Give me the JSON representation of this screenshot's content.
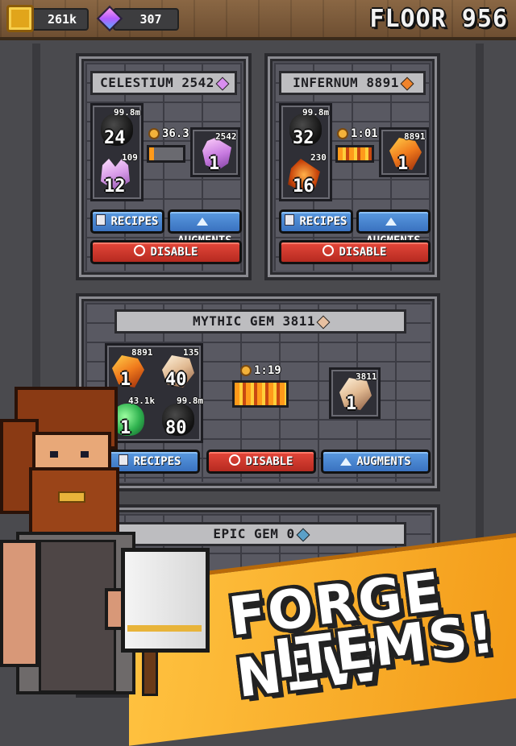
{
  "header": {
    "gold_amount": "261k",
    "gem_amount": "307",
    "floor_label": "FLOOR 956",
    "gold_icon": "gold-coin-icon",
    "gem_icon": "purple-gem-icon"
  },
  "forges": [
    {
      "title": "CELESTIUM 2542",
      "inputs": [
        {
          "icon": "coal-icon",
          "stock": "99.8m",
          "required": "24"
        },
        {
          "icon": "celestium-crystal-icon",
          "stock": "109",
          "required": "12"
        }
      ],
      "timer": "36.3",
      "progress": 0.15,
      "output": {
        "icon": "celestium-bar-icon",
        "stock": "2542",
        "count": "1"
      },
      "recipes_label": "RECIPES",
      "augments_label": "AUGMENTS",
      "disable_label": "DISABLE"
    },
    {
      "title": "INFERNUM 8891",
      "inputs": [
        {
          "icon": "coal-icon",
          "stock": "99.8m",
          "required": "32"
        },
        {
          "icon": "infernum-ember-icon",
          "stock": "230",
          "required": "16"
        }
      ],
      "timer": "1:01",
      "progress": 1.0,
      "output": {
        "icon": "infernum-bar-icon",
        "stock": "8891",
        "count": "1"
      },
      "recipes_label": "RECIPES",
      "augments_label": "AUGMENTS",
      "disable_label": "DISABLE"
    },
    {
      "title": "MYTHIC GEM 3811",
      "inputs": [
        {
          "icon": "infernum-bar-icon",
          "stock": "8891",
          "required": "1"
        },
        {
          "icon": "mythic-shard-icon",
          "stock": "135",
          "required": "40"
        },
        {
          "icon": "emerald-icon",
          "stock": "43.1k",
          "required": "1"
        },
        {
          "icon": "coal-icon",
          "stock": "99.8m",
          "required": "80"
        }
      ],
      "timer": "1:19",
      "progress": 1.0,
      "output": {
        "icon": "mythic-gem-icon",
        "stock": "3811",
        "count": "1"
      },
      "recipes_label": "RECIPES",
      "augments_label": "AUGMENTS",
      "disable_label": "DISABLE"
    },
    {
      "title": "EPIC GEM 0"
    }
  ],
  "promo": {
    "line1": "FORGE NEW",
    "line2": "ITEMS!"
  },
  "colors": {
    "accent_orange": "#f39a17",
    "button_blue": "#3a72c0",
    "button_red": "#b62a20"
  }
}
